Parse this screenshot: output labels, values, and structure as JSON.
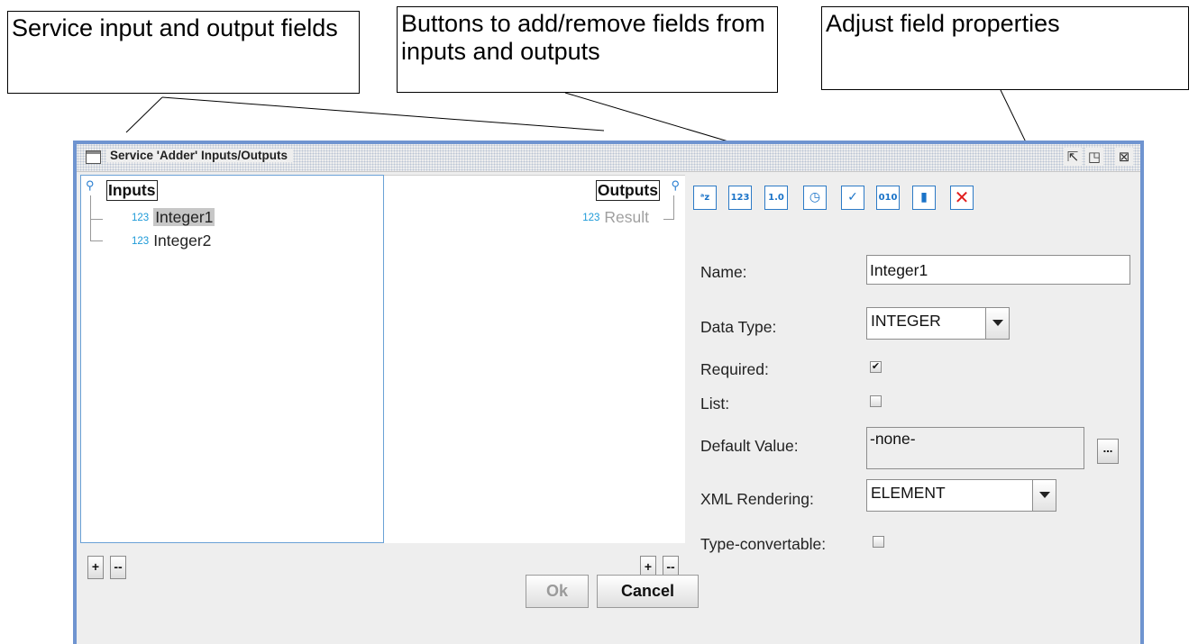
{
  "callouts": {
    "fields": "Service input and output fields",
    "buttons": "Buttons to add/remove fields from inputs and outputs",
    "properties": "Adjust field properties"
  },
  "window": {
    "title": "Service 'Adder' Inputs/Outputs",
    "controls": [
      "restore-icon",
      "maximize-icon",
      "close-icon"
    ]
  },
  "inputs": {
    "root_label": "Inputs",
    "items": [
      {
        "type_icon": "123",
        "label": "Integer1",
        "selected": true
      },
      {
        "type_icon": "123",
        "label": "Integer2",
        "selected": false
      }
    ],
    "add_label": "+",
    "remove_label": "--"
  },
  "outputs": {
    "root_label": "Outputs",
    "items": [
      {
        "type_icon": "123",
        "label": "Result"
      }
    ],
    "add_label": "+",
    "remove_label": "--"
  },
  "toolbar": {
    "buttons": [
      {
        "icon": "text-field-icon",
        "glyph": "ᵃz"
      },
      {
        "icon": "integer-field-icon",
        "glyph": "123"
      },
      {
        "icon": "decimal-field-icon",
        "glyph": "1.0"
      },
      {
        "icon": "datetime-field-icon",
        "glyph": "◷"
      },
      {
        "icon": "boolean-field-icon",
        "glyph": "✓"
      },
      {
        "icon": "binary-field-icon",
        "glyph": "010"
      },
      {
        "icon": "record-field-icon",
        "glyph": "▮"
      },
      {
        "icon": "delete-field-icon",
        "glyph": "✕"
      }
    ]
  },
  "properties": {
    "name_label": "Name:",
    "name_value": "Integer1",
    "data_type_label": "Data Type:",
    "data_type_value": "INTEGER",
    "required_label": "Required:",
    "required_checked": true,
    "list_label": "List:",
    "list_checked": false,
    "default_label": "Default Value:",
    "default_value": "-none-",
    "default_button": "...",
    "xml_label": "XML Rendering:",
    "xml_value": "ELEMENT",
    "convertable_label": "Type-convertable:",
    "convertable_checked": false
  },
  "buttons": {
    "ok": "Ok",
    "cancel": "Cancel"
  },
  "colors": {
    "window_border": "#6f94d0",
    "icon_blue": "#1d9ad8",
    "delete_red": "#e11d1d"
  }
}
